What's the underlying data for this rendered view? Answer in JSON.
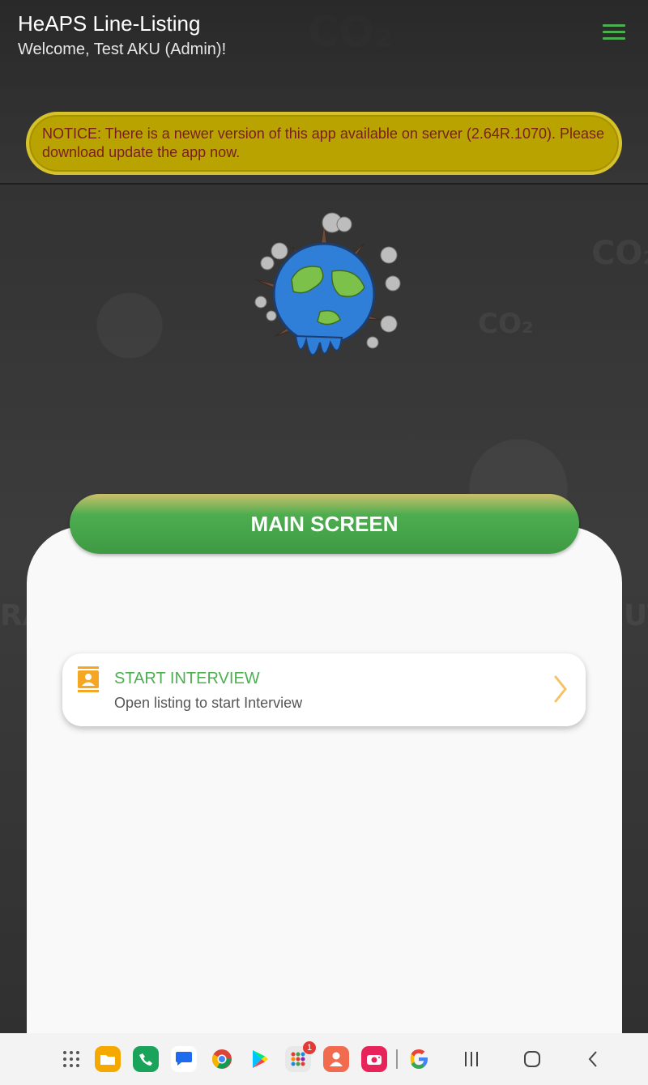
{
  "app": {
    "title": "HeAPS Line-Listing",
    "welcome": "Welcome, Test AKU (Admin)!"
  },
  "notice": {
    "text": "NOTICE: There is a newer version of this app available on server (2.64R.1070). Please download update the app now."
  },
  "main": {
    "section_title": "MAIN SCREEN",
    "items": [
      {
        "title": "START INTERVIEW",
        "subtitle": "Open listing to start Interview",
        "icon": "contact-card-icon"
      }
    ]
  },
  "taskbar": {
    "apps": [
      "apps-grid-icon",
      "files-icon",
      "phone-icon",
      "messages-icon",
      "chrome-icon",
      "play-store-icon",
      "app-folder-icon",
      "contacts-icon",
      "camera-icon",
      "google-icon"
    ],
    "badge_count": "1"
  },
  "colors": {
    "accent": "#4caf50",
    "notice_bg": "#b8a300",
    "notice_text": "#7a1f1f"
  }
}
